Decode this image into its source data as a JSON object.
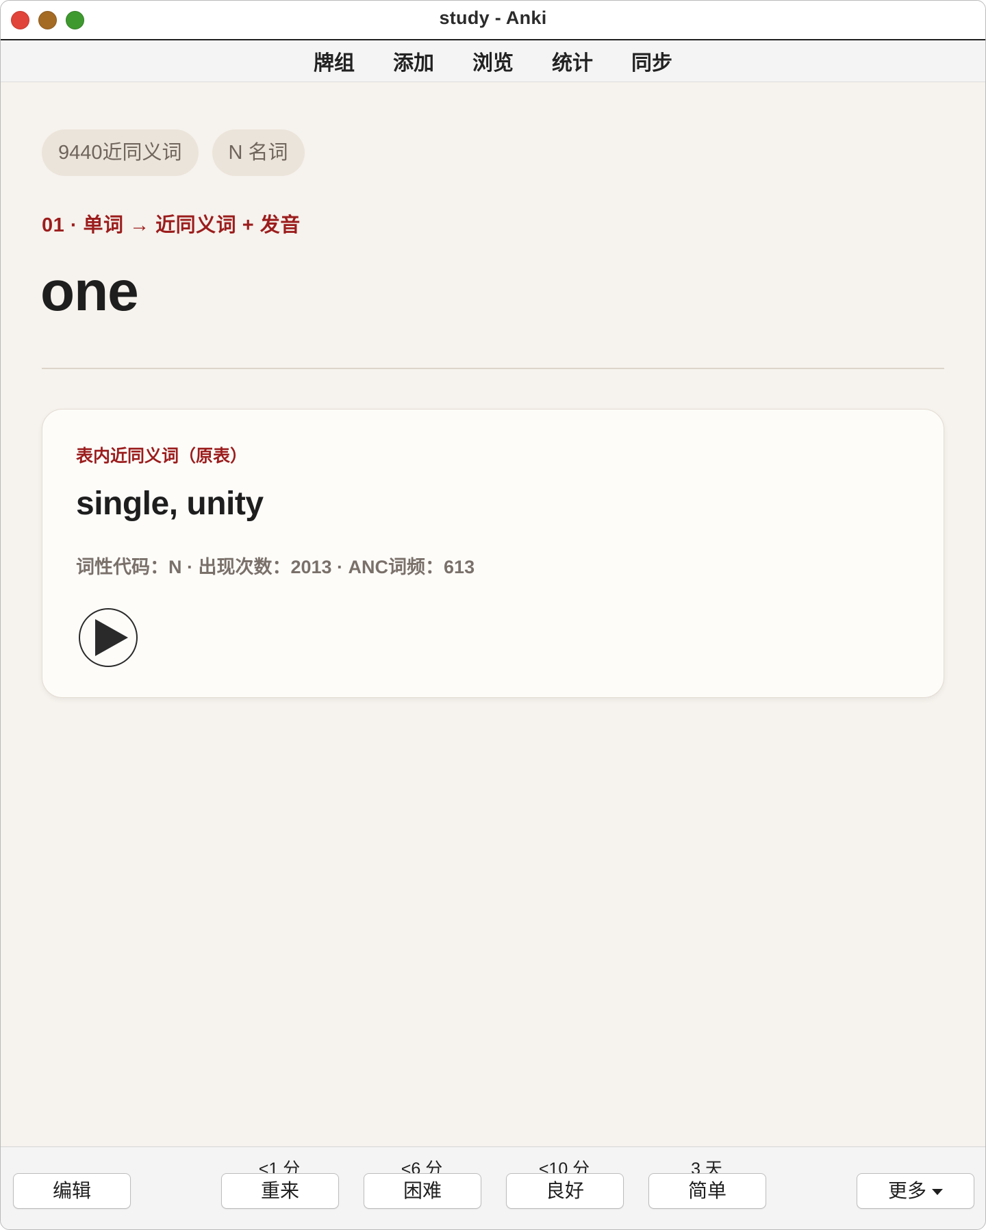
{
  "window": {
    "title": "study - Anki"
  },
  "top_nav": {
    "items": [
      {
        "label": "牌组"
      },
      {
        "label": "添加"
      },
      {
        "label": "浏览"
      },
      {
        "label": "统计"
      },
      {
        "label": "同步"
      }
    ]
  },
  "card": {
    "tags": [
      "9440近同义词",
      "N 名词"
    ],
    "route": "01 · 单词 → 近同义词 + 发音",
    "word": "one",
    "panel": {
      "label": "表内近同义词（原表）",
      "synonyms": "single, unity",
      "meta": "词性代码：N · 出现次数：2013 · ANC词频：613",
      "play_icon": "play-icon"
    }
  },
  "bottom_bar": {
    "edit_label": "编辑",
    "answers": [
      {
        "label": "重来",
        "due": "<1 分"
      },
      {
        "label": "困难",
        "due": "<6 分"
      },
      {
        "label": "良好",
        "due": "<10 分"
      },
      {
        "label": "简单",
        "due": "3 天"
      }
    ],
    "more_label": "更多"
  },
  "colors": {
    "accent_red": "#9b1d1d",
    "background": "#f6f2ed",
    "card_background": "#fdfcf9",
    "tag_background": "#ebe4da"
  }
}
